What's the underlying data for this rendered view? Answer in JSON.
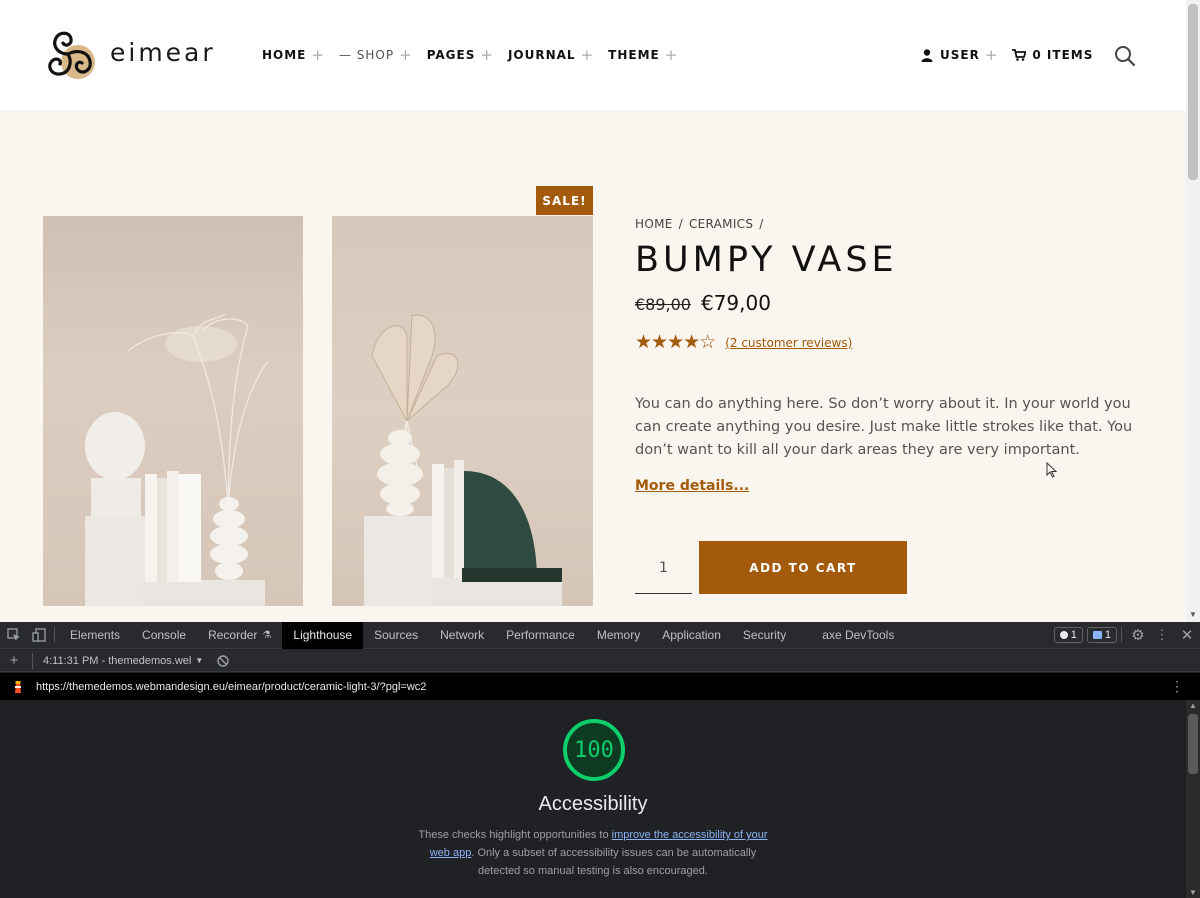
{
  "site": {
    "logo_text": "eimear",
    "nav": [
      {
        "label": "HOME"
      },
      {
        "label": "— SHOP"
      },
      {
        "label": "PAGES"
      },
      {
        "label": "JOURNAL"
      },
      {
        "label": "THEME"
      }
    ],
    "user_label": "USER",
    "cart_label": "0 ITEMS",
    "accent": "#a35a0a"
  },
  "product": {
    "sale_badge": "SALE!",
    "breadcrumb": [
      "HOME",
      "/",
      "CERAMICS",
      "/"
    ],
    "title": "BUMPY VASE",
    "old_price": "€89,00",
    "price": "€79,00",
    "rating": 4,
    "rating_max": 5,
    "reviews_link": "(2 customer reviews)",
    "description": "You can do anything here. So don’t worry about it. In your world you can create anything you desire. Just make little strokes like that. You don’t want to kill all your dark areas they are very important.",
    "more_details": "More details...",
    "quantity": "1",
    "add_to_cart": "ADD TO CART"
  },
  "devtools": {
    "tabs": [
      "Elements",
      "Console",
      "Recorder",
      "Lighthouse",
      "Sources",
      "Network",
      "Performance",
      "Memory",
      "Application",
      "Security",
      "axe DevTools"
    ],
    "active_tab": "Lighthouse",
    "errors_count": "1",
    "messages_count": "1",
    "report_time": "4:11:31 PM - themedemos.wel",
    "url": "https://themedemos.webmandesign.eu/eimear/product/ceramic-light-3/?pgl=wc2",
    "score": "100",
    "category": "Accessibility",
    "desc_before": "These checks highlight opportunities to ",
    "desc_link": "improve the accessibility of your web app",
    "desc_after": ". Only a subset of accessibility issues can be automatically detected so manual testing is also encouraged.",
    "score_color": "#0cce6b"
  }
}
